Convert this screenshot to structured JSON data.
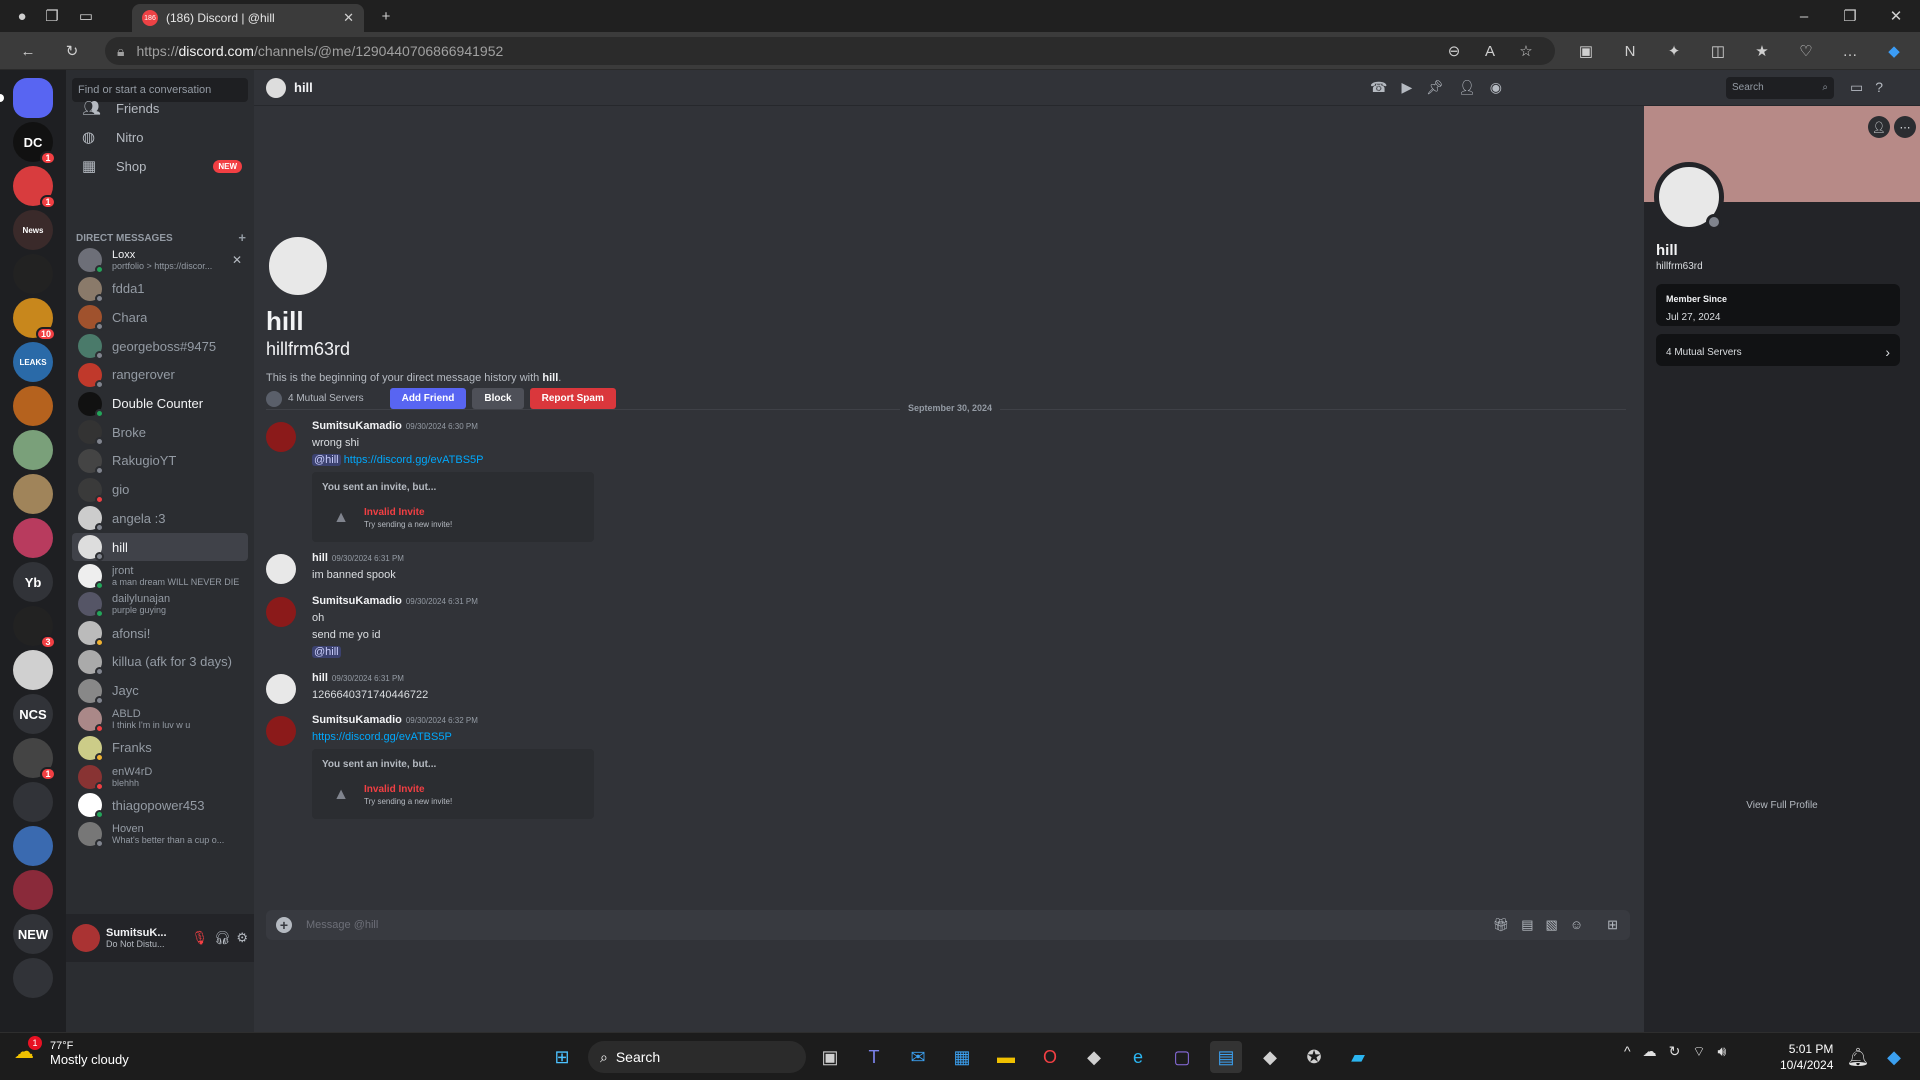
{
  "browser": {
    "tab_title": "(186) Discord | @hill",
    "tab_badge": "186",
    "url_prefix": "https://",
    "url_host": "discord.com",
    "url_path": "/channels/@me/1290440706866941952"
  },
  "sidebar": {
    "find_placeholder": "Find or start a conversation",
    "friends": "Friends",
    "nitro": "Nitro",
    "shop": "Shop",
    "shop_badge": "NEW",
    "dm_header": "DIRECT MESSAGES",
    "dms": [
      {
        "name": "Loxx",
        "sub": "portfolio > https://discor...",
        "status": "on"
      },
      {
        "name": "fdda1",
        "sub": "",
        "status": "off"
      },
      {
        "name": "Chara",
        "sub": "",
        "status": "off"
      },
      {
        "name": "georgeboss#9475",
        "sub": "",
        "status": "off"
      },
      {
        "name": "rangerover",
        "sub": "",
        "status": "off"
      },
      {
        "name": "Double Counter",
        "sub": "",
        "status": "on"
      },
      {
        "name": "Broke",
        "sub": "",
        "status": "off"
      },
      {
        "name": "RakugioYT",
        "sub": "",
        "status": "off"
      },
      {
        "name": "gio",
        "sub": "",
        "status": "dnd"
      },
      {
        "name": "angela :3",
        "sub": "",
        "status": "off"
      },
      {
        "name": "hill",
        "sub": "",
        "status": "off"
      },
      {
        "name": "jront",
        "sub": "a man dream WILL NEVER DIE",
        "status": "on"
      },
      {
        "name": "dailylunajan",
        "sub": "purple guying",
        "status": "on"
      },
      {
        "name": "afonsi!",
        "sub": "",
        "status": "idle"
      },
      {
        "name": "killua (afk for 3 days)",
        "sub": "",
        "status": "off"
      },
      {
        "name": "Jayc",
        "sub": "",
        "status": "off"
      },
      {
        "name": "ABLD",
        "sub": "I think I'm in luv w u",
        "status": "dnd"
      },
      {
        "name": "Franks",
        "sub": "",
        "status": "idle"
      },
      {
        "name": "enW4rD",
        "sub": "blehhh",
        "status": "dnd"
      },
      {
        "name": "thiagopower453",
        "sub": "",
        "status": "on"
      },
      {
        "name": "Hoven",
        "sub": "What's better than a cup o...",
        "status": "off"
      }
    ],
    "servers": [
      {
        "label": "",
        "color": "#5865f2",
        "ping": ""
      },
      {
        "label": "DC",
        "color": "#111111",
        "ping": "1"
      },
      {
        "label": "",
        "color": "#d83c3e",
        "ping": "1"
      },
      {
        "label": "News",
        "color": "#3a2a2a",
        "ping": ""
      },
      {
        "label": "",
        "color": "#222222",
        "ping": ""
      },
      {
        "label": "",
        "color": "#c8871c",
        "ping": "10"
      },
      {
        "label": "LEAKS",
        "color": "#2a6aa8",
        "ping": ""
      },
      {
        "label": "",
        "color": "#b5621e",
        "ping": ""
      },
      {
        "label": "",
        "color": "#7aa07a",
        "ping": ""
      },
      {
        "label": "",
        "color": "#a0845a",
        "ping": ""
      },
      {
        "label": "",
        "color": "#b83b5e",
        "ping": ""
      },
      {
        "label": "Yb",
        "color": "#313338",
        "ping": ""
      },
      {
        "label": "",
        "color": "#222222",
        "ping": "3"
      },
      {
        "label": "",
        "color": "#d0d0d0",
        "ping": ""
      },
      {
        "label": "NCS",
        "color": "#313338",
        "ping": ""
      },
      {
        "label": "",
        "color": "#444444",
        "ping": "1"
      },
      {
        "label": "",
        "color": "#313338",
        "ping": ""
      },
      {
        "label": "",
        "color": "#3a6ab0",
        "ping": ""
      },
      {
        "label": "",
        "color": "#8a2a3a",
        "ping": ""
      },
      {
        "label": "NEW",
        "color": "#313338",
        "ping": ""
      },
      {
        "label": "",
        "color": "#313338",
        "ping": ""
      }
    ]
  },
  "user": {
    "name": "SumitsuK...",
    "status": "Do Not Distu..."
  },
  "header": {
    "name": "hill",
    "search_placeholder": "Search"
  },
  "intro": {
    "display_name": "hill",
    "username": "hillfrm63rd",
    "desc_prefix": "This is the beginning of your direct message history with ",
    "desc_name": "hill",
    "desc_suffix": ".",
    "mutual": "4 Mutual Servers",
    "add_friend": "Add Friend",
    "block": "Block",
    "report": "Report Spam",
    "date_divider": "September 30, 2024"
  },
  "messages": [
    {
      "author": "SumitsuKamadio",
      "ts": "09/30/2024 6:30 PM",
      "lines": [
        "wrong shi"
      ],
      "mention": "@hill",
      "link": "https://discord.gg/evATBS5P",
      "invite": true
    },
    {
      "author": "hill",
      "ts": "09/30/2024 6:31 PM",
      "lines": [
        "im  banned spook"
      ]
    },
    {
      "author": "SumitsuKamadio",
      "ts": "09/30/2024 6:31 PM",
      "lines": [
        "oh",
        "send me yo id"
      ],
      "mention": "@hill"
    },
    {
      "author": "hill",
      "ts": "09/30/2024 6:31 PM",
      "lines": [
        "1266640371740446722"
      ]
    },
    {
      "author": "SumitsuKamadio",
      "ts": "09/30/2024 6:32 PM",
      "link": "https://discord.gg/evATBS5P",
      "invite": true
    }
  ],
  "invite": {
    "heading": "You sent an invite, but...",
    "title": "Invalid Invite",
    "subtitle": "Try sending a new invite!"
  },
  "composer": {
    "placeholder": "Message @hill"
  },
  "profile": {
    "display_name": "hill",
    "username": "hillfrm63rd",
    "member_since_label": "Member Since",
    "member_since": "Jul 27, 2024",
    "mutual": "4 Mutual Servers",
    "view_full": "View Full Profile"
  },
  "taskbar": {
    "temp": "77°F",
    "condition": "Mostly cloudy",
    "weather_badge": "1",
    "search": "Search",
    "time": "5:01 PM",
    "date": "10/4/2024"
  }
}
